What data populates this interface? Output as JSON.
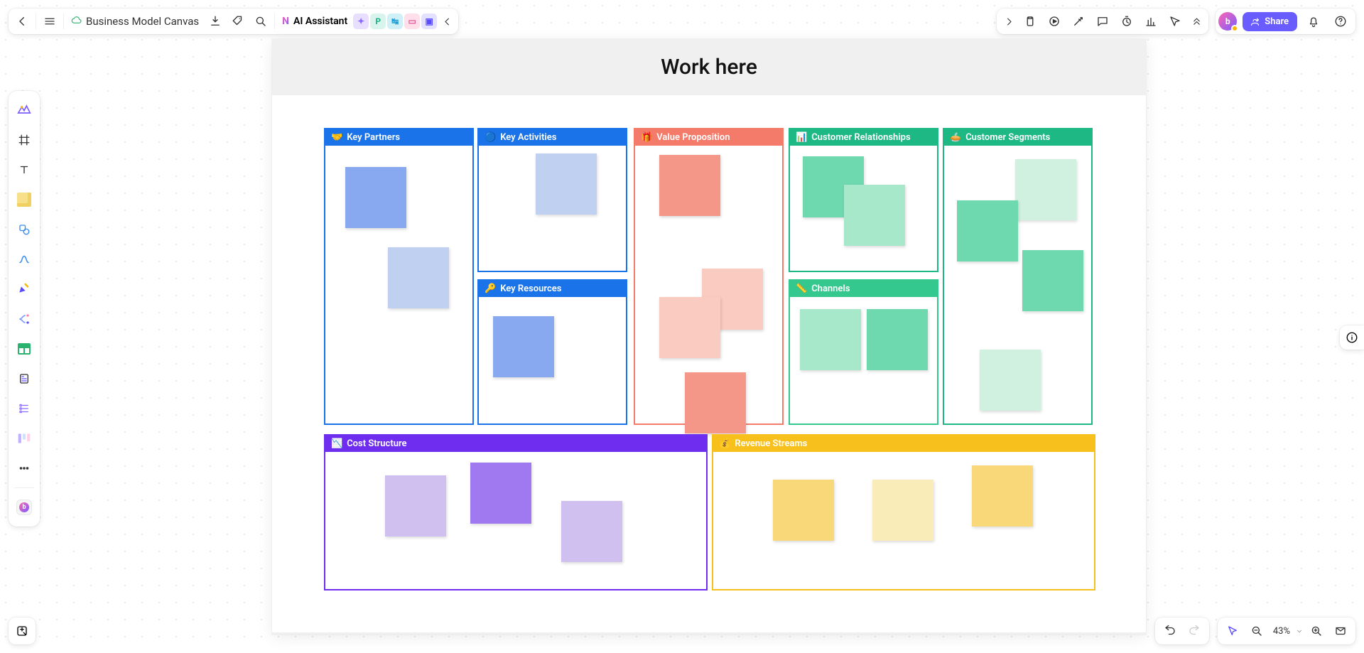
{
  "header": {
    "doc_title": "Business Model Canvas",
    "ai_label": "AI Assistant",
    "share_label": "Share"
  },
  "frame": {
    "title": "Work here"
  },
  "zones": {
    "key_partners": {
      "label": "Key Partners",
      "emoji": "🤝",
      "color": "#1a73e8"
    },
    "key_activities": {
      "label": "Key Activities",
      "emoji": "🔵",
      "color": "#1a73e8"
    },
    "key_resources": {
      "label": "Key Resources",
      "emoji": "🔑",
      "color": "#1a73e8"
    },
    "value_proposition": {
      "label": "Value Proposition",
      "emoji": "🎁",
      "color": "#f47a6a"
    },
    "customer_relationships": {
      "label": "Customer Relationships",
      "emoji": "📊",
      "color": "#1db884"
    },
    "channels": {
      "label": "Channels",
      "emoji": "📏",
      "color": "#34c88f"
    },
    "customer_segments": {
      "label": "Customer Segments",
      "emoji": "🥧",
      "color": "#1db884"
    },
    "cost_structure": {
      "label": "Cost Structure",
      "emoji": "📉",
      "color": "#6f2df0"
    },
    "revenue_streams": {
      "label": "Revenue Streams",
      "emoji": "💰",
      "color": "#f8c01c"
    }
  },
  "footer": {
    "zoom": "43%"
  }
}
